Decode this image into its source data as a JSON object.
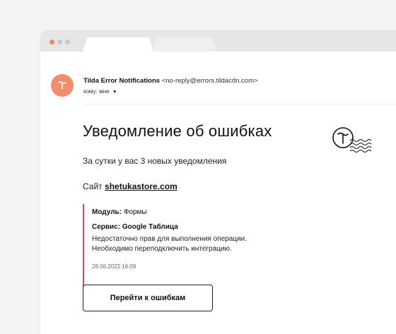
{
  "sender": {
    "name": "Tilda Error Notifications",
    "email": "<no-reply@errors.tildacdn.com>",
    "recipient": "кому: мне"
  },
  "email": {
    "title": "Уведомление об ошибках",
    "subtitle": "За сутки у вас 3 новых уведомления",
    "site_label": "Сайт",
    "site_link": "shetukastore.com",
    "error": {
      "module_label": "Модуль:",
      "module_value": "Формы",
      "service": "Сервис: Google Таблица",
      "message_line1": "Недостаточно прав для выполнения операции.",
      "message_line2": "Необходимо переподключить интеграцию.",
      "date": "28.06.2022 16:09"
    },
    "button_label": "Перейти к ошибкам"
  },
  "colors": {
    "avatar": "#f28d6c",
    "error_border": "#e34b4b",
    "window_dot_red": "#f08a6a"
  },
  "icons": {
    "avatar": "tilda-logo-icon",
    "recipient_dropdown": "caret-down-icon",
    "brand_stamp": "tilda-stamp-icon"
  }
}
